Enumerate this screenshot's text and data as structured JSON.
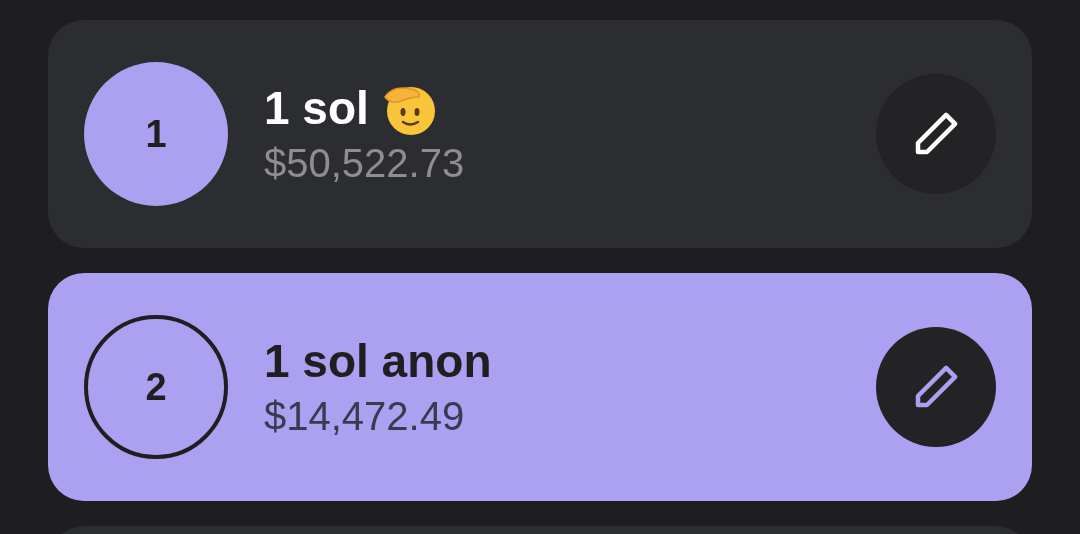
{
  "accounts": [
    {
      "number": "1",
      "name": "1 sol",
      "has_emoji": true,
      "balance": "$50,522.73",
      "selected": false
    },
    {
      "number": "2",
      "name": "1 sol anon",
      "has_emoji": false,
      "balance": "$14,472.49",
      "selected": true
    }
  ]
}
